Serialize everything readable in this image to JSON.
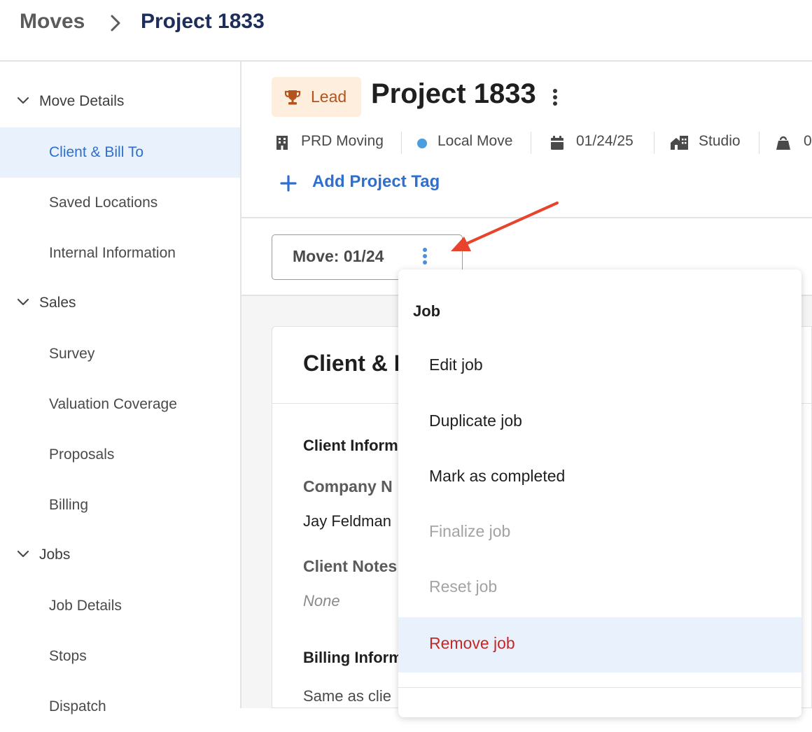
{
  "breadcrumb": {
    "root": "Moves",
    "current": "Project 1833"
  },
  "sidebar": {
    "sections": [
      {
        "label": "Move Details",
        "items": [
          "Client & Bill To",
          "Saved Locations",
          "Internal Information"
        ]
      },
      {
        "label": "Sales",
        "items": [
          "Survey",
          "Valuation Coverage",
          "Proposals",
          "Billing"
        ]
      },
      {
        "label": "Jobs",
        "items": [
          "Job Details",
          "Stops",
          "Dispatch"
        ]
      }
    ],
    "active_item": "Client & Bill To"
  },
  "project": {
    "status_badge": "Lead",
    "title": "Project 1833",
    "meta": {
      "company": "PRD Moving",
      "move_type": "Local Move",
      "date": "01/24/25",
      "size": "Studio",
      "truncated": "0"
    },
    "add_tag_label": "Add Project Tag"
  },
  "job_selector": {
    "label": "Move: 01/24"
  },
  "card": {
    "title": "Client & B",
    "client_info_heading": "Client Inform",
    "company_name_label": "Company N",
    "company_name_value": "Jay Feldman",
    "client_notes_label": "Client Notes",
    "client_notes_value": "None",
    "billing_info_heading": "Billing Inform",
    "billing_same_value": "Same as clie"
  },
  "job_menu": {
    "header": "Job",
    "items": [
      {
        "label": "Edit job",
        "state": "enabled"
      },
      {
        "label": "Duplicate job",
        "state": "enabled"
      },
      {
        "label": "Mark as completed",
        "state": "enabled"
      },
      {
        "label": "Finalize job",
        "state": "disabled"
      },
      {
        "label": "Reset job",
        "state": "disabled"
      },
      {
        "label": "Remove job",
        "state": "danger"
      }
    ]
  },
  "colors": {
    "brand_blue": "#2f6fce",
    "breadcrumb_navy": "#1d2d5c",
    "lead_badge_bg": "#fdeedd",
    "lead_badge_text": "#b3541e",
    "danger_red": "#c62828",
    "active_item_bg": "#e8f1fc",
    "annotation_arrow": "#e8432d",
    "local_move_dot": "#4a9ee0"
  }
}
